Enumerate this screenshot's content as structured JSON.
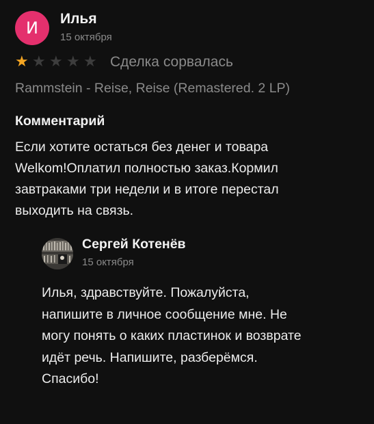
{
  "review": {
    "author": {
      "initial": "И",
      "name": "Илья",
      "date": "15 октября",
      "avatar_color": "#e4306d"
    },
    "rating": {
      "value": 1,
      "max": 5,
      "status": "Сделка сорвалась"
    },
    "product": "Rammstein - Reise, Reise (Remastered. 2 LP)",
    "comment_heading": "Комментарий",
    "comment_lines": [
      "Если хотите остаться без денег и товара",
      "Welkom!Оплатил полностью заказ.Кормил",
      "завтраками три недели и в итоге перестал",
      "выходить на связь."
    ]
  },
  "reply": {
    "author": {
      "name": "Сергей Котенёв",
      "date": "15 октября",
      "avatar_icon": "record-shelf-photo-icon"
    },
    "lines": [
      "Илья, здравствуйте. Пожалуйста,",
      "напишите в личное сообщение мне. Не",
      "могу понять о каких пластинок и возврате",
      "идёт речь. Напишите, разберёмся.",
      "Спасибо!"
    ]
  },
  "colors": {
    "background": "#101010",
    "star_filled": "#f5a623",
    "star_empty": "#3d3d3d",
    "muted_text": "#8a8a8a"
  }
}
